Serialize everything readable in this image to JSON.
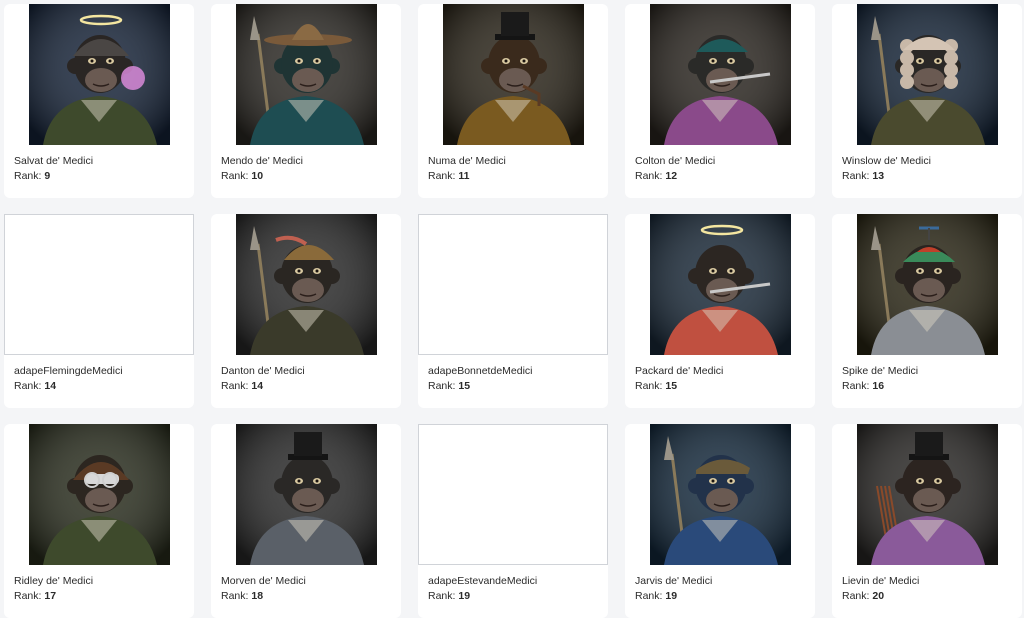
{
  "rank_label": "Rank:",
  "cards": [
    {
      "name": "Salvat de' Medici",
      "rank": "9",
      "image": "salvat-portrait",
      "bg": "#16243a",
      "fur": "#2a2624",
      "coat": "#3e4a2c",
      "hat": "helmet",
      "halo": true,
      "accessory": "bubblegum"
    },
    {
      "name": "Mendo de' Medici",
      "rank": "10",
      "image": "mendo-portrait",
      "bg": "#2c2924",
      "fur": "#1f3434",
      "coat": "#1e4d52",
      "hat": "sombrero",
      "halo": false,
      "accessory": "sword"
    },
    {
      "name": "Numa de' Medici",
      "rank": "11",
      "image": "numa-portrait",
      "bg": "#2a2418",
      "fur": "#3a2a1c",
      "coat": "#7a5a20",
      "hat": "tophat",
      "halo": false,
      "accessory": "pipe"
    },
    {
      "name": "Colton de' Medici",
      "rank": "12",
      "image": "colton-portrait",
      "bg": "#2b2620",
      "fur": "#2a2a28",
      "coat": "#8a4a8a",
      "hat": "cap",
      "halo": false,
      "accessory": "knife"
    },
    {
      "name": "Winslow de' Medici",
      "rank": "13",
      "image": "winslow-portrait",
      "bg": "#142438",
      "fur": "#2a2826",
      "coat": "#4a4a2e",
      "hat": "wig",
      "halo": false,
      "accessory": "spear"
    },
    {
      "name": "adapeFlemingdeMedici",
      "rank": "14",
      "image": "",
      "bg": "",
      "fur": "",
      "coat": "",
      "hat": "",
      "halo": false,
      "accessory": ""
    },
    {
      "name": "Danton de' Medici",
      "rank": "14",
      "image": "danton-portrait",
      "bg": "#2a2a2a",
      "fur": "#2a2622",
      "coat": "#3a3a2a",
      "hat": "feathered",
      "halo": false,
      "accessory": "sword"
    },
    {
      "name": "adapeBonnetdeMedici",
      "rank": "15",
      "image": "",
      "bg": "",
      "fur": "",
      "coat": "",
      "hat": "",
      "halo": false,
      "accessory": ""
    },
    {
      "name": "Packard de' Medici",
      "rank": "15",
      "image": "packard-portrait",
      "bg": "#1a2a3a",
      "fur": "#2c2622",
      "coat": "#c05040",
      "hat": "none",
      "halo": true,
      "accessory": "dart"
    },
    {
      "name": "Spike de' Medici",
      "rank": "16",
      "image": "spike-portrait",
      "bg": "#2a2614",
      "fur": "#2a2420",
      "coat": "#8a8e94",
      "hat": "propeller",
      "halo": false,
      "accessory": "sword"
    },
    {
      "name": "Ridley de' Medici",
      "rank": "17",
      "image": "ridley-portrait",
      "bg": "#2a2e1e",
      "fur": "#2c2620",
      "coat": "#3e4a2c",
      "hat": "aviator",
      "halo": false,
      "accessory": "goggles"
    },
    {
      "name": "Morven de' Medici",
      "rank": "18",
      "image": "morven-portrait",
      "bg": "#2a2a2a",
      "fur": "#2a2826",
      "coat": "#5a6068",
      "hat": "tophat",
      "halo": false,
      "accessory": "none"
    },
    {
      "name": "adapeEstevandeMedici",
      "rank": "19",
      "image": "",
      "bg": "",
      "fur": "",
      "coat": "",
      "hat": "",
      "halo": false,
      "accessory": ""
    },
    {
      "name": "Jarvis de' Medici",
      "rank": "19",
      "image": "jarvis-portrait",
      "bg": "#142a3e",
      "fur": "#22324a",
      "coat": "#2a4a7a",
      "hat": "flatcap",
      "halo": false,
      "accessory": "spear"
    },
    {
      "name": "Lievin de' Medici",
      "rank": "20",
      "image": "lievin-portrait",
      "bg": "#2a2826",
      "fur": "#2c2420",
      "coat": "#8a5a9a",
      "hat": "tophat",
      "halo": false,
      "accessory": "arrows"
    }
  ]
}
